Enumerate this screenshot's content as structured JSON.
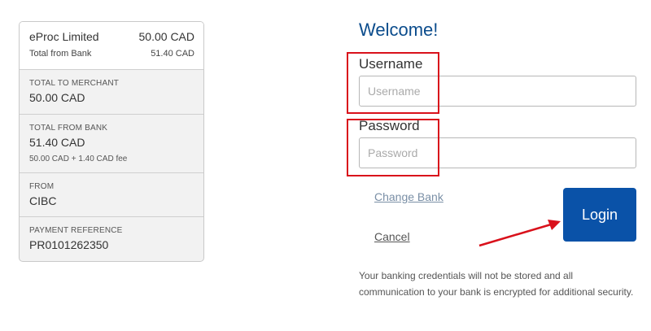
{
  "summary": {
    "merchant": "eProc Limited",
    "amount": "50.00 CAD",
    "total_from_bank_label": "Total from Bank",
    "total_from_bank_value": "51.40 CAD",
    "sections": [
      {
        "label": "TOTAL TO MERCHANT",
        "value": "50.00 CAD"
      },
      {
        "label": "TOTAL FROM BANK",
        "value": "51.40 CAD",
        "note": "50.00 CAD  +  1.40 CAD fee"
      },
      {
        "label": "FROM",
        "value": "CIBC"
      },
      {
        "label": "PAYMENT REFERENCE",
        "value": "PR0101262350"
      }
    ]
  },
  "login": {
    "welcome": "Welcome!",
    "username_label": "Username",
    "username_placeholder": "Username",
    "username_value": "",
    "password_label": "Password",
    "password_placeholder": "Password",
    "password_value": "",
    "change_bank_link": "Change Bank",
    "cancel_link": "Cancel",
    "login_button": "Login",
    "security_note": "Your banking credentials will not be stored and all communication to your bank is encrypted for additional security."
  },
  "colors": {
    "accent": "#0a52a8",
    "heading": "#0b4c8c",
    "annotation_red": "#d9111b"
  }
}
